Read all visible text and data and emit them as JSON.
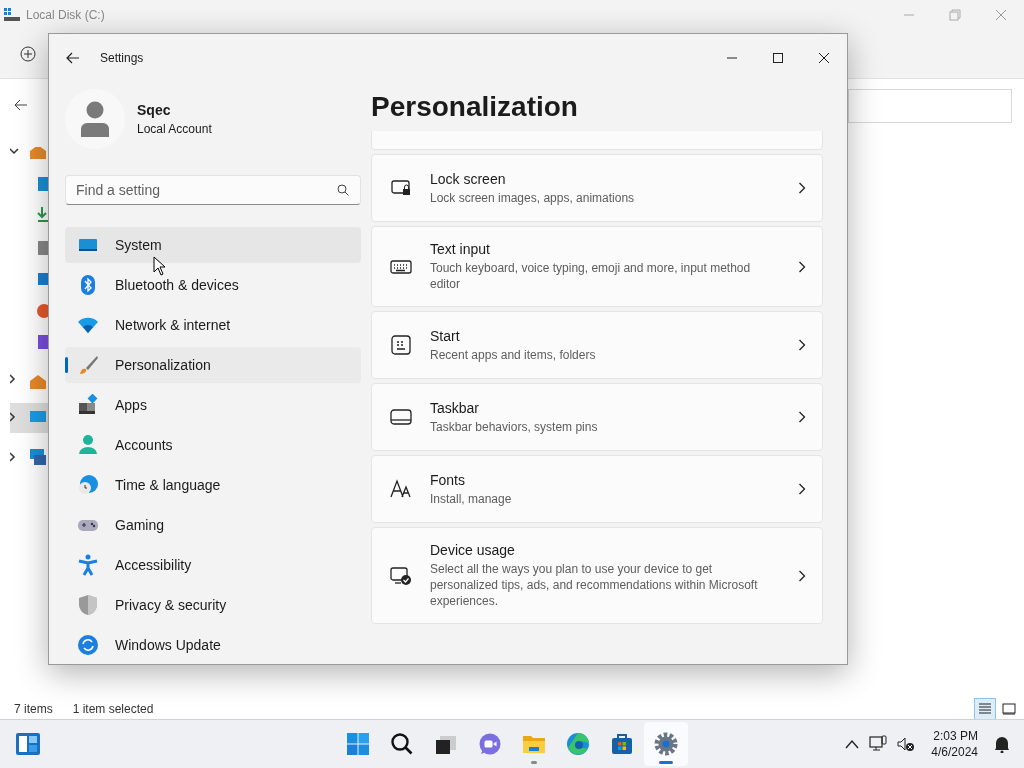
{
  "explorer": {
    "title": "Local Disk (C:)",
    "status": [
      "7 items",
      "1 item selected"
    ],
    "views": [
      {
        "kind": "details",
        "selected": true
      },
      {
        "kind": "tiles",
        "selected": false
      }
    ]
  },
  "settings": {
    "title": "Settings",
    "user": {
      "name": "Sqec",
      "account": "Local Account"
    },
    "search": {
      "placeholder": "Find a setting"
    },
    "nav": [
      {
        "label": "System",
        "selected": false,
        "hovered": true
      },
      {
        "label": "Bluetooth & devices",
        "selected": false,
        "hovered": false
      },
      {
        "label": "Network & internet",
        "selected": false,
        "hovered": false
      },
      {
        "label": "Personalization",
        "selected": true,
        "hovered": false
      },
      {
        "label": "Apps",
        "selected": false,
        "hovered": false
      },
      {
        "label": "Accounts",
        "selected": false,
        "hovered": false
      },
      {
        "label": "Time & language",
        "selected": false,
        "hovered": false
      },
      {
        "label": "Gaming",
        "selected": false,
        "hovered": false
      },
      {
        "label": "Accessibility",
        "selected": false,
        "hovered": false
      },
      {
        "label": "Privacy & security",
        "selected": false,
        "hovered": false
      },
      {
        "label": "Windows Update",
        "selected": false,
        "hovered": false
      }
    ],
    "page_title": "Personalization",
    "cards": [
      {
        "title": "Lock screen",
        "subtitle": "Lock screen images, apps, animations"
      },
      {
        "title": "Text input",
        "subtitle": "Touch keyboard, voice typing, emoji and more, input method editor"
      },
      {
        "title": "Start",
        "subtitle": "Recent apps and items, folders"
      },
      {
        "title": "Taskbar",
        "subtitle": "Taskbar behaviors, system pins"
      },
      {
        "title": "Fonts",
        "subtitle": "Install, manage"
      },
      {
        "title": "Device usage",
        "subtitle": "Select all the ways you plan to use your device to get personalized tips, ads, and recommendations within Microsoft experiences."
      }
    ]
  },
  "taskbar": {
    "apps": [
      {
        "kind": "start",
        "running": false,
        "selected": false
      },
      {
        "kind": "search",
        "running": false,
        "selected": false
      },
      {
        "kind": "taskview",
        "running": false,
        "selected": false
      },
      {
        "kind": "chat",
        "running": false,
        "selected": false
      },
      {
        "kind": "explorer",
        "running": true,
        "selected": false
      },
      {
        "kind": "edge",
        "running": false,
        "selected": false
      },
      {
        "kind": "store",
        "running": false,
        "selected": false
      },
      {
        "kind": "settings",
        "running": true,
        "selected": true
      }
    ],
    "time": "2:03 PM",
    "date": "4/6/2024"
  }
}
